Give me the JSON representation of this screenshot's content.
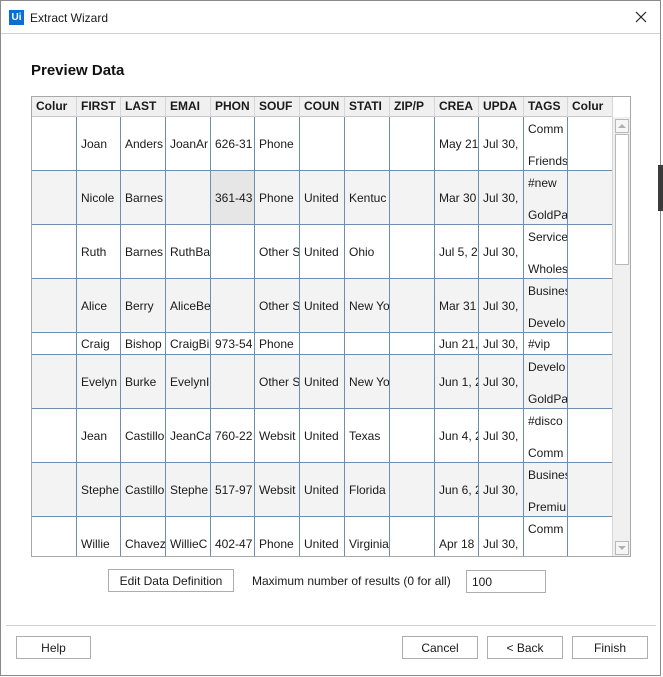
{
  "window": {
    "app_icon_label": "Ui",
    "title": "Extract Wizard",
    "close_icon": "close-icon"
  },
  "page": {
    "heading": "Preview Data"
  },
  "table": {
    "columns": [
      "Colur",
      "FIRST",
      "LAST",
      "EMAI",
      "PHON",
      "SOUF",
      "COUN",
      "STATI",
      "ZIP/P",
      "CREA",
      "UPDA",
      "TAGS",
      "Colur"
    ],
    "rows": [
      {
        "cells": [
          "",
          "Joan",
          "Anders",
          "JoanAr",
          "626-31",
          "Phone",
          "",
          "",
          "",
          "May 21",
          "Jul 30,",
          "Comm|Friends",
          ""
        ]
      },
      {
        "cells": [
          "",
          "Nicole",
          "Barnes",
          "",
          "361-43",
          "Phone",
          "United",
          "Kentuc",
          "",
          "Mar 30",
          "Jul 30,",
          "#new|GoldPa",
          ""
        ],
        "selected_cell": 4
      },
      {
        "cells": [
          "",
          "Ruth",
          "Barnes",
          "RuthBa",
          "",
          "Other S",
          "United",
          "Ohio",
          "",
          "Jul 5, 2",
          "Jul 30,",
          "Service|Wholes",
          ""
        ]
      },
      {
        "cells": [
          "",
          "Alice",
          "Berry",
          "AliceBe",
          "",
          "Other S",
          "United",
          "New Yo",
          "",
          "Mar 31",
          "Jul 30,",
          "Busines|Develo",
          ""
        ]
      },
      {
        "cells": [
          "",
          "Craig",
          "Bishop",
          "CraigBi",
          "973-54",
          "Phone",
          "",
          "",
          "",
          "Jun 21,",
          "Jul 30,",
          "#vip",
          ""
        ],
        "short": true
      },
      {
        "cells": [
          "",
          "Evelyn",
          "Burke",
          "EvelynI",
          "",
          "Other S",
          "United",
          "New Yo",
          "",
          "Jun 1, 2",
          "Jul 30,",
          "Develo|GoldPa",
          ""
        ]
      },
      {
        "cells": [
          "",
          "Jean",
          "Castillo",
          "JeanCa",
          "760-22",
          "Websit",
          "United",
          "Texas",
          "",
          "Jun 4, 2",
          "Jul 30,",
          "#disco|Comm",
          ""
        ]
      },
      {
        "cells": [
          "",
          "Stephe",
          "Castillo",
          "Stephe",
          "517-97",
          "Websit",
          "United",
          "Florida",
          "",
          "Jun 6, 2",
          "Jul 30,",
          "Busines|Premiu",
          ""
        ]
      },
      {
        "cells": [
          "",
          "Willie",
          "Chavez",
          "WillieC",
          "402-47",
          "Phone",
          "United",
          "Virginia",
          "",
          "Apr 18",
          "Jul 30,",
          "Comm|Friends",
          ""
        ]
      }
    ]
  },
  "controls": {
    "edit_button": "Edit Data Definition",
    "max_results_label": "Maximum number of results (0 for all)",
    "max_results_value": "100"
  },
  "footer": {
    "help": "Help",
    "cancel": "Cancel",
    "back": "< Back",
    "finish": "Finish"
  }
}
